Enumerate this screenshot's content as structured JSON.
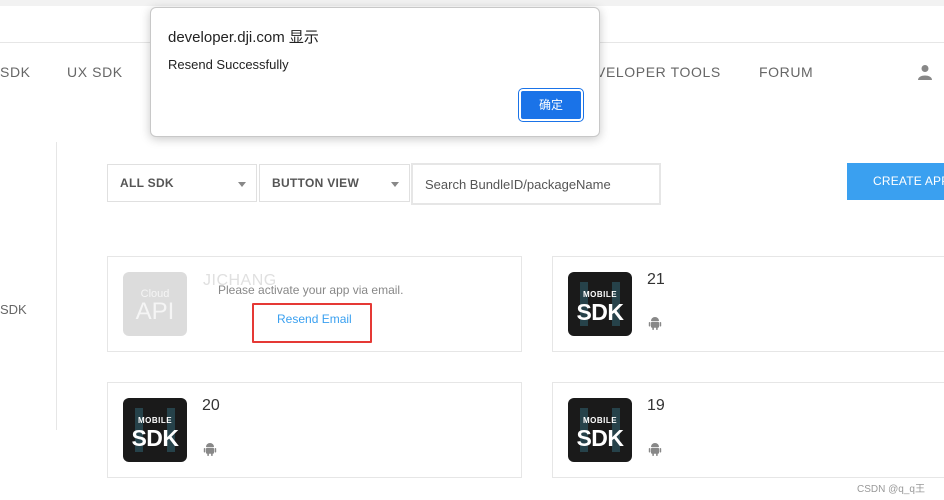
{
  "nav": {
    "items": [
      "SDK",
      "UX SDK",
      "VELOPER TOOLS",
      "FORUM"
    ]
  },
  "sidebar": {
    "label": "SDK"
  },
  "filters": {
    "sdk_select": "ALL SDK",
    "view_select": "BUTTON VIEW",
    "search_placeholder": "Search BundleID/packageName",
    "create_label": "CREATE APP"
  },
  "cards": [
    {
      "name": "JICHANG",
      "logo_top": "Cloud",
      "logo_bottom": "API",
      "message": "Please activate your app via email.",
      "link": "Resend Email"
    },
    {
      "name": "21",
      "logo_top": "MOBILE",
      "logo_bottom": "SDK",
      "platform_icon": "android-icon"
    },
    {
      "name": "20",
      "logo_top": "MOBILE",
      "logo_bottom": "SDK",
      "platform_icon": "android-icon"
    },
    {
      "name": "19",
      "logo_top": "MOBILE",
      "logo_bottom": "SDK",
      "platform_icon": "android-icon"
    }
  ],
  "dialog": {
    "title": "developer.dji.com 显示",
    "message": "Resend Successfully",
    "ok_label": "确定"
  },
  "watermark": "CSDN @q_q王",
  "colors": {
    "accent": "#3aa0f0",
    "dialog_button": "#1a73e8",
    "highlight": "#e53935",
    "sdk_logo_bg": "#1a1a1a"
  }
}
